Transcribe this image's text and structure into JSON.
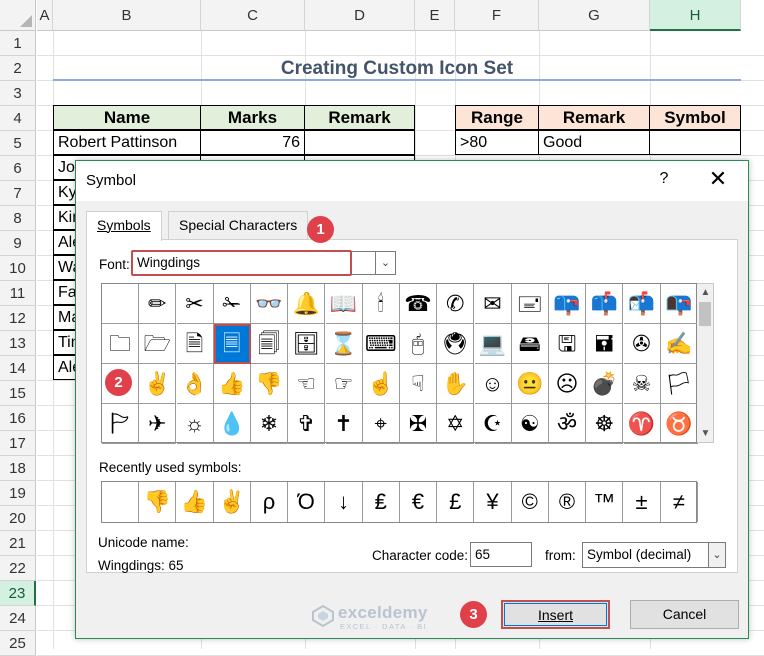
{
  "sheet": {
    "columns": [
      "A",
      "B",
      "C",
      "D",
      "E",
      "F",
      "G",
      "H"
    ],
    "selected_column": "H",
    "rows": [
      "1",
      "2",
      "3",
      "4",
      "5",
      "6",
      "7",
      "8",
      "9",
      "10",
      "11",
      "12",
      "13",
      "14",
      "15",
      "16",
      "17",
      "18",
      "19",
      "20",
      "21",
      "22",
      "23",
      "24",
      "25"
    ],
    "selected_row": "23",
    "title": "Creating Custom Icon Set",
    "table1": {
      "headers": [
        "Name",
        "Marks",
        "Remark"
      ],
      "rows": [
        {
          "name": "Robert Pattinson",
          "marks": "76",
          "remark": ""
        },
        {
          "name": "Jo",
          "marks": "",
          "remark": ""
        },
        {
          "name": "Ky",
          "marks": "",
          "remark": ""
        },
        {
          "name": "Kin",
          "marks": "",
          "remark": ""
        },
        {
          "name": "Ale",
          "marks": "",
          "remark": ""
        },
        {
          "name": "Wa",
          "marks": "",
          "remark": ""
        },
        {
          "name": "Fal",
          "marks": "",
          "remark": ""
        },
        {
          "name": "Ma",
          "marks": "",
          "remark": ""
        },
        {
          "name": "Tin",
          "marks": "",
          "remark": ""
        },
        {
          "name": "Ale",
          "marks": "",
          "remark": ""
        }
      ]
    },
    "table2": {
      "headers": [
        "Range",
        "Remark",
        "Symbol"
      ],
      "rows": [
        {
          "range": ">80",
          "remark": "Good",
          "symbol": ""
        }
      ]
    }
  },
  "dialog": {
    "title": "Symbol",
    "help": "?",
    "close": "✕",
    "tabs": [
      "Symbols",
      "Special Characters"
    ],
    "font_label": "Font:",
    "font_value": "Wingdings",
    "recent_label": "Recently used symbols:",
    "unicode_name_label": "Unicode name:",
    "unicode_name_value": "Wingdings: 65",
    "char_code_label": "Character code:",
    "char_code_value": "65",
    "from_label": "from:",
    "from_value": "Symbol (decimal)",
    "insert_label": "Insert",
    "cancel_label": "Cancel",
    "selected_index": 19,
    "symbols": [
      "",
      "✏",
      "✂",
      "✁",
      "👓",
      "🔔",
      "📖",
      "🕯",
      "☎",
      "✆",
      "✉",
      "🖃",
      "📪",
      "📫",
      "📬",
      "📭",
      "🗀",
      "🗁",
      "🗎",
      "🗏",
      "🗐",
      "🗄",
      "⌛",
      "⌨",
      "🖰",
      "🖲",
      "💻",
      "🖴",
      "🖫",
      "🖬",
      "✇",
      "✍",
      "",
      "✌",
      "👌",
      "👍",
      "👎",
      "☜",
      "☞",
      "☝",
      "☟",
      "✋",
      "☺",
      "😐",
      "☹",
      "💣",
      "☠",
      "🏳",
      "🏱",
      "✈",
      "☼",
      "💧",
      "❄",
      "✞",
      "✝",
      "⌖",
      "✠",
      "✡",
      "☪",
      "☯",
      "ॐ",
      "☸",
      "♈",
      "♉"
    ],
    "recent_symbols": [
      "",
      "👎",
      "👍",
      "✌",
      "ρ",
      "Ό",
      "↓",
      "₤",
      "€",
      "£",
      "¥",
      "©",
      "®",
      "™",
      "±",
      "≠"
    ]
  },
  "watermark": {
    "name": "exceldemy",
    "tagline": "EXCEL · DATA · BI"
  },
  "badges": [
    "1",
    "2",
    "3"
  ],
  "colors": {
    "accent": "#217346",
    "badge": "#e0404a",
    "highlight": "#c0504d",
    "selection": "#0078d7"
  }
}
